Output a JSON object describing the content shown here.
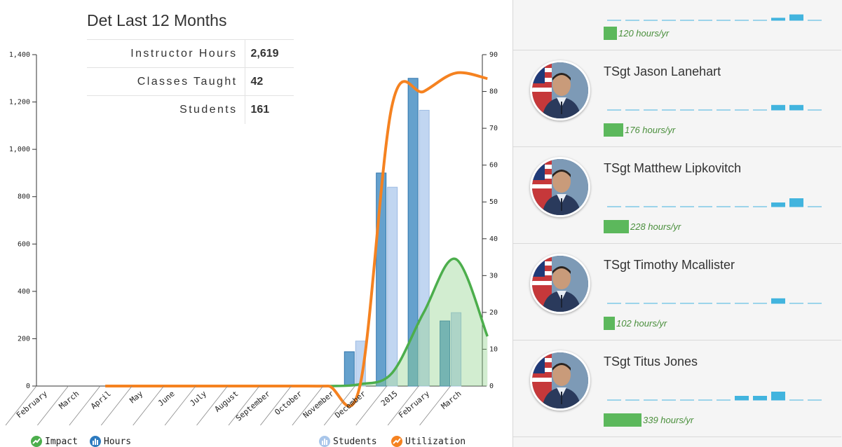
{
  "chart_panel": {
    "title": "Det Last 12 Months",
    "stats": [
      {
        "label": "Instructor Hours",
        "value": "2,619"
      },
      {
        "label": "Classes Taught",
        "value": "42"
      },
      {
        "label": "Students",
        "value": "161"
      }
    ]
  },
  "chart_data": {
    "type": "bar",
    "categories": [
      "February",
      "March",
      "April",
      "May",
      "June",
      "July",
      "August",
      "September",
      "October",
      "November",
      "December",
      "2015",
      "February",
      "March"
    ],
    "left_axis": {
      "ticks": [
        "0",
        "200",
        "400",
        "600",
        "800",
        "1,000",
        "1,200",
        "1,400"
      ],
      "ylim": [
        0,
        1400
      ]
    },
    "right_axis": {
      "ticks": [
        "0",
        "10",
        "20",
        "30",
        "40",
        "50",
        "60",
        "70",
        "80",
        "90"
      ],
      "ylim": [
        0,
        90
      ]
    },
    "series": [
      {
        "name": "Hours",
        "kind": "bar",
        "axis": "left",
        "color": "#4a90c4",
        "values": [
          0,
          0,
          0,
          0,
          0,
          0,
          0,
          0,
          0,
          145,
          900,
          1300,
          275,
          0
        ]
      },
      {
        "name": "Students",
        "kind": "bar",
        "axis": "left",
        "color": "#b6cfee",
        "values": [
          0,
          0,
          0,
          0,
          0,
          0,
          0,
          0,
          0,
          190,
          840,
          1165,
          310,
          0
        ]
      },
      {
        "name": "Impact",
        "kind": "area",
        "axis": "right",
        "color": "#4cae4c",
        "values": [
          0,
          0,
          0,
          0,
          0,
          0,
          0,
          0,
          0,
          0.5,
          3.5,
          20,
          34.5,
          13.5
        ]
      },
      {
        "name": "Utilization",
        "kind": "line",
        "axis": "right",
        "color": "#f58220",
        "values": [
          0,
          0,
          0,
          0,
          0,
          0,
          0,
          0,
          0,
          0.2,
          76,
          80,
          85,
          83.5
        ]
      }
    ],
    "legend": [
      {
        "name": "Impact",
        "color": "#4cae4c",
        "icon": "trend-line-icon"
      },
      {
        "name": "Hours",
        "color": "#2e7bbf",
        "icon": "bar-chart-icon"
      },
      {
        "name": "Students",
        "color": "#a9c6ea",
        "icon": "bar-chart-icon"
      },
      {
        "name": "Utilization",
        "color": "#f58220",
        "icon": "trend-line-icon"
      }
    ],
    "legend_position": "bottom",
    "grid": false
  },
  "people": [
    {
      "name": "",
      "hours": "120 hours/yr",
      "hours_value": 120,
      "monthly": [
        0,
        0,
        0,
        0,
        0,
        0,
        0,
        0,
        0,
        0.3,
        0.7,
        0
      ]
    },
    {
      "name": "TSgt Jason Lanehart",
      "hours": "176 hours/yr",
      "hours_value": 176,
      "monthly": [
        0,
        0,
        0,
        0,
        0,
        0,
        0,
        0,
        0,
        0.6,
        0.6,
        0
      ]
    },
    {
      "name": "TSgt Matthew Lipkovitch",
      "hours": "228 hours/yr",
      "hours_value": 228,
      "monthly": [
        0,
        0,
        0,
        0,
        0,
        0,
        0,
        0,
        0,
        0.5,
        1.0,
        0
      ]
    },
    {
      "name": "TSgt Timothy Mcallister",
      "hours": "102 hours/yr",
      "hours_value": 102,
      "monthly": [
        0,
        0,
        0,
        0,
        0,
        0,
        0,
        0,
        0,
        0.6,
        0,
        0
      ]
    },
    {
      "name": "TSgt Titus Jones",
      "hours": "339 hours/yr",
      "hours_value": 339,
      "monthly": [
        0,
        0,
        0,
        0,
        0,
        0,
        0,
        0.5,
        0.5,
        1.0,
        0,
        0
      ]
    }
  ],
  "colors": {
    "mini_bar": "#42b4de",
    "hours_bar": "#5cb85c",
    "hours_text": "#4a8f3c"
  }
}
